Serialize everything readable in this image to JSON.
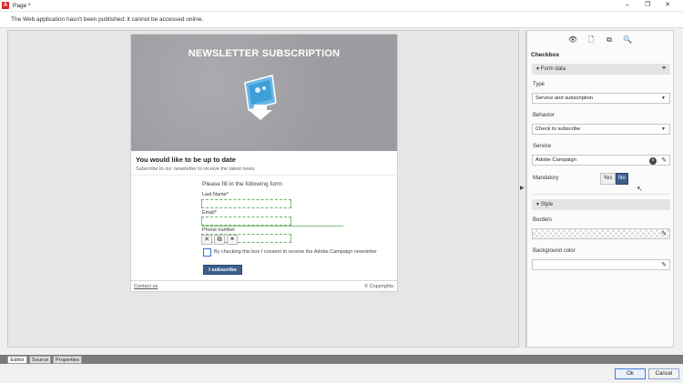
{
  "window": {
    "app_icon": "A",
    "title": "Page *",
    "controls": [
      "–",
      "❐",
      "✕"
    ]
  },
  "warning": "The Web application hasn't been published: it cannot be accessed online.",
  "preview": {
    "hero_title": "NEWSLETTER SUBSCRIPTION",
    "intro_title": "You would like to be up to date",
    "intro_subtitle": "Subscribe to our newsletter to receive the latest news.",
    "form_prompt": "Please fill in the following form:",
    "fields": [
      {
        "label": "Last Name*"
      },
      {
        "label": "Email*"
      },
      {
        "label": "Phone number"
      }
    ],
    "phone_tools": [
      "✕",
      "⧉",
      "⚭"
    ],
    "consent_text": "By checking this box I consent to receive the Adobe Campaign newsletter",
    "subscribe_label": "I subscribe",
    "contact_link": "Contact us",
    "copyright": "© Copyrights"
  },
  "panel": {
    "toolbar_icons": [
      "eye-icon",
      "add-page-icon",
      "copy-icon",
      "zoom-icon"
    ],
    "title": "Checkbox",
    "form_data_section": "Form data",
    "type_label": "Type",
    "type_value": "Service and subscription",
    "behavior_label": "Behavior",
    "behavior_value": "Check to subscribe",
    "service_label": "Service",
    "service_value": "Adobe Campaign",
    "mandatory_label": "Mandatory",
    "mandatory_yes": "Yes",
    "mandatory_no": "No",
    "mandatory_selected": "No",
    "style_section": "Style",
    "borders_label": "Borders",
    "background_color_label": "Background color"
  },
  "tabs": [
    {
      "label": "Editor",
      "active": true
    },
    {
      "label": "Source",
      "active": false
    },
    {
      "label": "Properties",
      "active": false
    }
  ],
  "buttons": {
    "ok": "Ok",
    "cancel": "Cancel"
  },
  "colors": {
    "accent": "#3d5f8c",
    "hero_bg": "#9f9fa3",
    "field_border": "#6cb06c",
    "brand_red": "#d9262b"
  }
}
